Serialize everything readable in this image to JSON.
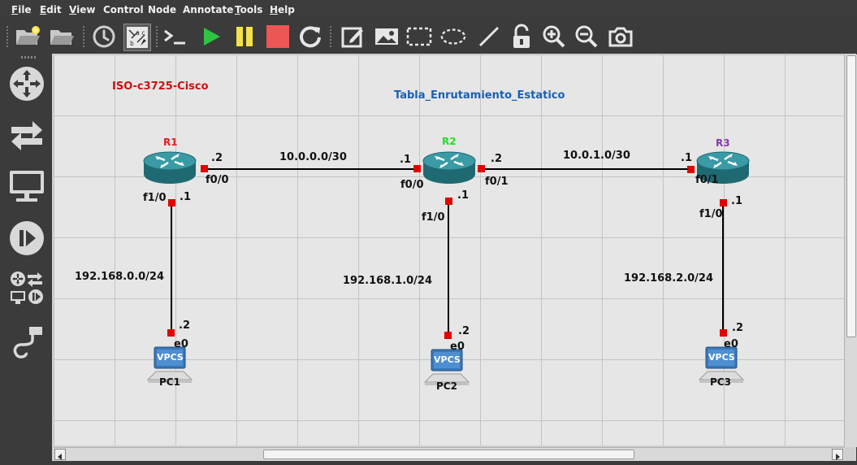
{
  "menu": {
    "file": "File",
    "edit": "Edit",
    "view": "View",
    "control": "Control",
    "node": "Node",
    "annotate": "Annotate",
    "tools": "Tools",
    "help": "Help"
  },
  "toolbar": {
    "icons": [
      "open-project-icon",
      "open-folder-icon",
      "snapshot-clock-icon",
      "show-interface-labels-icon",
      "console-icon",
      "start-icon",
      "suspend-icon",
      "stop-icon",
      "reload-icon",
      "add-note-icon",
      "insert-picture-icon",
      "draw-rectangle-icon",
      "draw-ellipse-icon",
      "draw-line-icon",
      "lock-icon",
      "zoom-in-icon",
      "zoom-out-icon",
      "screenshot-icon"
    ]
  },
  "dock": {
    "icons": [
      "routers-icon",
      "switches-icon",
      "end-devices-icon",
      "security-devices-icon",
      "all-devices-icon",
      "add-link-icon"
    ]
  },
  "notes": {
    "ios_image": "ISO-c3725-Cisco",
    "title": "Tabla_Enrutamiento_Estatico"
  },
  "routers": {
    "r1": {
      "name": "R1",
      "color": "#e02020"
    },
    "r2": {
      "name": "R2",
      "color": "#22dd22"
    },
    "r3": {
      "name": "R3",
      "color": "#8a3aa8"
    }
  },
  "pcs": {
    "pc1": {
      "name": "PC1",
      "badge": "VPCS"
    },
    "pc2": {
      "name": "PC2",
      "badge": "VPCS"
    },
    "pc3": {
      "name": "PC3",
      "badge": "VPCS"
    }
  },
  "networks": {
    "r1_r2": "10.0.0.0/30",
    "r2_r3": "10.0.1.0/30",
    "lan1": "192.168.0.0/24",
    "lan2": "192.168.1.0/24",
    "lan3": "192.168.2.0/24"
  },
  "interfaces": {
    "r1_f00": "f0/0",
    "r1_f00_ip": ".2",
    "r1_f10": "f1/0",
    "r1_f10_ip": ".1",
    "r2_f00": "f0/0",
    "r2_f00_ip": ".1",
    "r2_f01": "f0/1",
    "r2_f01_ip": ".2",
    "r2_f10": "f1/0",
    "r2_f10_ip": ".1",
    "r3_f01": "f0/1",
    "r3_f01_ip": ".1",
    "r3_f10": "f1/0",
    "r3_f10_ip": ".1",
    "pc1_e0": "e0",
    "pc1_ip": ".2",
    "pc2_e0": "e0",
    "pc2_ip": ".2",
    "pc3_e0": "e0",
    "pc3_ip": ".2"
  },
  "colors": {
    "note_red": "#cc1111",
    "note_blue": "#1a5fb4",
    "port": "#e00000",
    "canvas_bg": "#e6e6e6"
  }
}
